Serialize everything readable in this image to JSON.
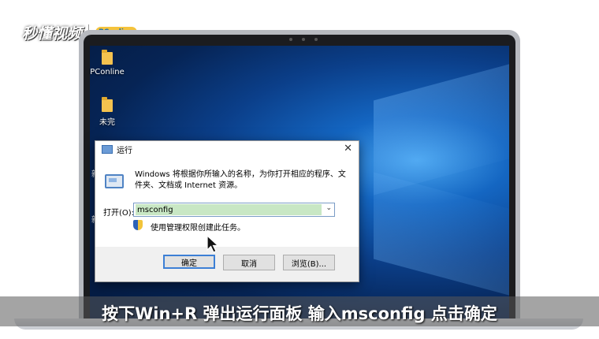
{
  "watermark": {
    "brand": "秒懂视频",
    "partner": "PConline"
  },
  "desktop": {
    "icons": [
      {
        "label": "PConline",
        "icon": "folder-icon"
      },
      {
        "label": "未完",
        "icon": "folder-icon"
      }
    ],
    "edge_labels": [
      "新",
      "新"
    ]
  },
  "run_dialog": {
    "title": "运行",
    "description": "Windows 将根据你所输入的名称，为你打开相应的程序、文件夹、文档或 Internet 资源。",
    "open_label": "打开(O):",
    "open_value": "msconfig",
    "uac_note": "使用管理权限创建此任务。",
    "buttons": {
      "ok": "确定",
      "cancel": "取消",
      "browse": "浏览(B)..."
    }
  },
  "caption": "按下Win+R 弹出运行面板 输入msconfig 点击确定",
  "colors": {
    "input_highlight": "#c8e7c4",
    "default_button_border": "#3c7fd5",
    "wallpaper_blue": "#1466c2"
  }
}
